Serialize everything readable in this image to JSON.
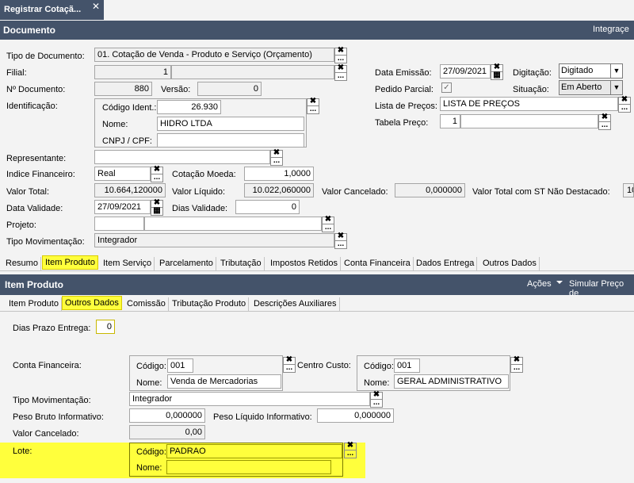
{
  "window": {
    "tab_title": "Registrar Cotaçã...",
    "close": "✕"
  },
  "header": {
    "title": "Documento",
    "right": "Integraçe"
  },
  "doc": {
    "tipo_label": "Tipo de Documento:",
    "tipo_value": "01. Cotação de Venda - Produto e Serviço (Orçamento)",
    "filial_label": "Filial:",
    "filial_value": "1",
    "num_label": "Nº Documento:",
    "num_value": "880",
    "versao_label": "Versão:",
    "versao_value": "0",
    "ident_label": "Identificação:",
    "codigo_label": "Código Ident.:",
    "codigo_value": "26.930",
    "nome_label": "Nome:",
    "nome_value": "HIDRO LTDA",
    "cnpj_label": "CNPJ / CPF:",
    "cnpj_value": "",
    "data_emissao_label": "Data Emissão:",
    "data_emissao_value": "27/09/2021",
    "digitacao_label": "Digitação:",
    "digitacao_value": "Digitado",
    "pedido_label": "Pedido Parcial:",
    "pedido_check": "✓",
    "situacao_label": "Situação:",
    "situacao_value": "Em Aberto",
    "lista_label": "Lista de Preços:",
    "lista_value": "LISTA DE PREÇOS",
    "tabela_label": "Tabela Preço:",
    "tabela_value": "1",
    "representante_label": "Representante:",
    "indice_label": "Indice Financeiro:",
    "indice_value": "Real",
    "cotacao_label": "Cotação Moeda:",
    "cotacao_value": "1,0000",
    "valor_total_label": "Valor Total:",
    "valor_total_value": "10.664,120000",
    "valor_liquido_label": "Valor Líquido:",
    "valor_liquido_value": "10.022,060000",
    "valor_cancelado_label": "Valor Cancelado:",
    "valor_cancelado_value": "0,000000",
    "valor_st_label": "Valor Total com ST Não Destacado:",
    "valor_st_value": "10",
    "data_validade_label": "Data Validade:",
    "data_validade_value": "27/09/2021",
    "dias_validade_label": "Dias Validade:",
    "dias_validade_value": "0",
    "projeto_label": "Projeto:",
    "tipo_mov_label": "Tipo Movimentação:",
    "tipo_mov_value": "Integrador"
  },
  "tabs": [
    "Resumo",
    "Item Produto",
    "Item Serviço",
    "Parcelamento",
    "Tributação",
    "Impostos Retidos",
    "Conta Financeira",
    "Dados Entrega",
    "Outros Dados"
  ],
  "item": {
    "title": "Item Produto",
    "acoes": "Ações",
    "simular": "Simular Preço de"
  },
  "subtabs": [
    "Item Produto",
    "Outros Dados",
    "Comissão",
    "Tributação Produto",
    "Descrições Auxiliares"
  ],
  "outros": {
    "dias_prazo_label": "Dias Prazo Entrega:",
    "dias_prazo_value": "0",
    "conta_label": "Conta Financeira:",
    "conta_codigo_label": "Código:",
    "conta_codigo_value": "001",
    "conta_nome_label": "Nome:",
    "conta_nome_value": "Venda de Mercadorias",
    "centro_label": "Centro Custo:",
    "centro_codigo_label": "Código:",
    "centro_codigo_value": "001",
    "centro_nome_label": "Nome:",
    "centro_nome_value": "GERAL ADMINISTRATIVO",
    "tipo_mov_label": "Tipo Movimentação:",
    "tipo_mov_value": "Integrador",
    "peso_bruto_label": "Peso Bruto Informativo:",
    "peso_bruto_value": "0,000000",
    "peso_liq_label": "Peso Líquido Informativo:",
    "peso_liq_value": "0,000000",
    "valor_cancelado_label": "Valor Cancelado:",
    "valor_cancelado_value": "0,00",
    "lote_label": "Lote:",
    "lote_codigo_label": "Código:",
    "lote_codigo_value": "PADRAO",
    "lote_nome_label": "Nome:",
    "lote_nome_value": ""
  },
  "glyphs": {
    "x": "✖",
    "dots": "...",
    "cal": "▦",
    "arrow": "▼"
  },
  "colors": {
    "highlight": "#ffff3c",
    "bar": "#44536a"
  }
}
